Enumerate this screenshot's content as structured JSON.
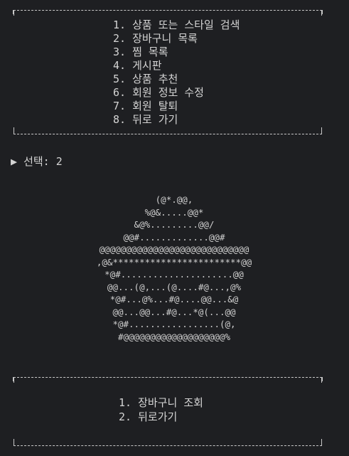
{
  "main_menu": {
    "items": [
      "1. 상품 또는 스타일 검색",
      "2. 장바구니 목록",
      "3. 찜 목록",
      "4. 게시판",
      "5. 상품 추천",
      "6. 회원 정보 수정",
      "7. 회원 탈퇴",
      "8. 뒤로 가기"
    ]
  },
  "prompt": {
    "marker": "▶",
    "text": "선택: 2"
  },
  "ascii_art": {
    "lines": [
      "(@*.@@,",
      "%@&.....@@*",
      "&@%.........@@/",
      "@@#.............@@#",
      "@@@@@@@@@@@@@@@@@@@@@@@@@@@@",
      ",@&************************@@",
      "*@#.....................@@",
      "@@...(@,...(@....#@...,@%",
      "*@#...@%...#@....@@...&@",
      "@@...@@...#@...*@(...@@",
      "*@#.................(@,",
      "#@@@@@@@@@@@@@@@@@@@%"
    ]
  },
  "sub_menu": {
    "items": [
      "1. 장바구니 조회",
      "2. 뒤로가기"
    ]
  },
  "colors": {
    "background": "#1e1f22",
    "text": "#d4d4d4",
    "border": "#c8c8c8"
  }
}
